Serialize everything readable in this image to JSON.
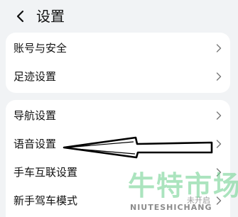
{
  "header": {
    "back_icon": "chevron-left-icon",
    "title": "设置"
  },
  "group1": {
    "items": [
      {
        "label": "账号与安全",
        "icon": "chevron-right-icon"
      },
      {
        "label": "足迹设置",
        "icon": "chevron-right-icon"
      }
    ]
  },
  "group2": {
    "items": [
      {
        "label": "导航设置",
        "icon": "chevron-right-icon"
      },
      {
        "label": "语音设置",
        "icon": "chevron-right-icon"
      },
      {
        "label": "手车互联设置",
        "icon": "chevron-right-icon"
      },
      {
        "label": "新手驾车模式",
        "status": "未开启",
        "icon": "chevron-right-icon"
      }
    ]
  },
  "annotation": {
    "type": "hand-drawn-arrow",
    "points_to": "语音设置"
  },
  "watermark": {
    "cn": "牛特市场",
    "en": "NIUTESHICHANG"
  },
  "colors": {
    "background": "#f1f3f5",
    "card": "#ffffff",
    "text": "#111111",
    "secondary_text": "#9a9a9a",
    "watermark_green": "#78d496"
  }
}
